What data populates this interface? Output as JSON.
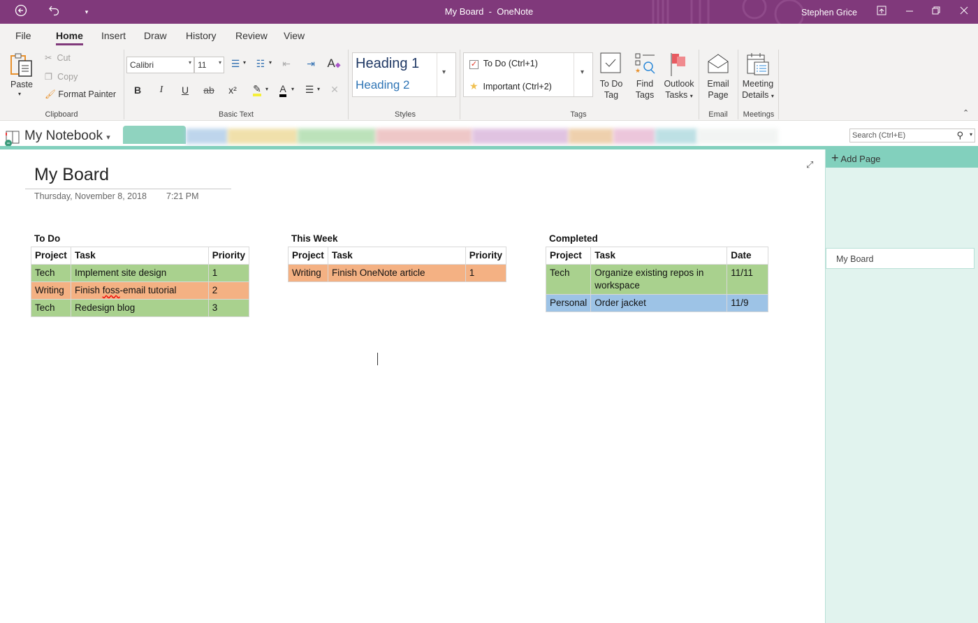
{
  "window": {
    "title": "My Board",
    "app": "OneNote",
    "title_sep": "-",
    "user": "Stephen Grice",
    "icons": {
      "back": "back-circle-icon",
      "undo": "undo-icon",
      "qat": "quick-access-dropdown-icon",
      "ribbon_display": "ribbon-display-icon",
      "minimize": "minimize-icon",
      "restore": "restore-icon",
      "close": "close-icon"
    }
  },
  "menu_tabs": [
    "File",
    "Home",
    "Insert",
    "Draw",
    "History",
    "Review",
    "View"
  ],
  "active_tab": "Home",
  "ribbon": {
    "clipboard": {
      "paste": "Paste",
      "cut": "Cut",
      "copy": "Copy",
      "format_painter": "Format Painter",
      "label": "Clipboard"
    },
    "basic_text": {
      "font": "Calibri",
      "size": "11",
      "label": "Basic Text",
      "bold": "B",
      "italic": "I",
      "underline": "U",
      "strike": "ab",
      "superscript": "x²",
      "font_color": "A"
    },
    "styles": {
      "heading1": "Heading 1",
      "heading2": "Heading 2",
      "label": "Styles"
    },
    "tags": {
      "todo": "To Do (Ctrl+1)",
      "important": "Important (Ctrl+2)",
      "todo_tag": [
        "To Do",
        "Tag"
      ],
      "find_tags": [
        "Find",
        "Tags"
      ],
      "outlook_tasks": [
        "Outlook",
        "Tasks"
      ],
      "label": "Tags"
    },
    "email": {
      "email_page": [
        "Email",
        "Page"
      ],
      "label": "Email"
    },
    "meetings": {
      "meeting_details": [
        "Meeting",
        "Details"
      ],
      "label": "Meetings"
    },
    "colors": {
      "accent": "#80397b"
    }
  },
  "notebook": {
    "name": "My Notebook",
    "search_placeholder": "Search (Ctrl+E)"
  },
  "section_tab_colors": [
    "#8fd3bf",
    "#a9c8e6",
    "#ecd690",
    "#a6d9a4",
    "#e9b5b5",
    "#d6b0d8",
    "#e9c192",
    "#e6b3cf",
    "#a8d6dc",
    "#eef1ef"
  ],
  "pages_pane": {
    "add_page": "Add Page",
    "pages": [
      "My Board"
    ]
  },
  "page": {
    "title": "My Board",
    "date": "Thursday, November 8, 2018",
    "time": "7:21 PM"
  },
  "boards": [
    {
      "title": "To Do",
      "headers": [
        "Project",
        "Task",
        "Priority"
      ],
      "rows": [
        {
          "cells": [
            "Tech",
            "Implement site design",
            "1"
          ],
          "color": "green"
        },
        {
          "cells": [
            "Writing",
            "Finish foss-email tutorial",
            "2"
          ],
          "color": "orange"
        },
        {
          "cells": [
            "Tech",
            "Redesign blog",
            "3"
          ],
          "color": "green"
        }
      ]
    },
    {
      "title": "This Week",
      "headers": [
        "Project",
        "Task",
        "Priority"
      ],
      "rows": [
        {
          "cells": [
            "Writing",
            "Finish OneNote article",
            "1"
          ],
          "color": "orange"
        }
      ]
    },
    {
      "title": "Completed",
      "headers": [
        "Project",
        "Task",
        "Date"
      ],
      "rows": [
        {
          "cells": [
            "Tech",
            "Organize existing repos in workspace",
            "11/11"
          ],
          "color": "green"
        },
        {
          "cells": [
            "Personal",
            "Order jacket",
            "11/9"
          ],
          "color": "blue"
        }
      ]
    }
  ],
  "row_colors": {
    "green": "#a9d18e",
    "orange": "#f4b183",
    "blue": "#9dc3e6"
  }
}
